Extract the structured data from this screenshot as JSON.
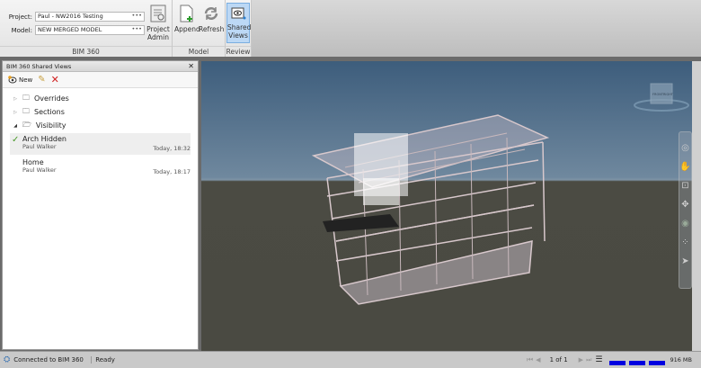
{
  "ribbon": {
    "project_label": "Project:",
    "project_value": "Paul - NW2016 Testing",
    "model_label": "Model:",
    "model_value": "NEW MERGED MODEL",
    "more": "•••",
    "project_admin": "Project Admin",
    "group_bim360": "BIM 360",
    "append": "Append",
    "refresh": "Refresh",
    "group_model": "Model",
    "shared_views": "Shared Views",
    "group_review": "Review"
  },
  "panel": {
    "title": "BIM 360 Shared Views",
    "new_label": "New",
    "folders": [
      {
        "label": "Overrides"
      },
      {
        "label": "Sections"
      },
      {
        "label": "Visibility"
      }
    ],
    "views": [
      {
        "name": "Arch Hidden",
        "user": "Paul Walker",
        "time": "Today, 18:32",
        "selected": true
      },
      {
        "name": "Home",
        "user": "Paul Walker",
        "time": "Today, 18:17",
        "selected": false
      }
    ]
  },
  "viewcube": {
    "front": "FRONT",
    "right": "RIGHT"
  },
  "status": {
    "connection": "Connected to BIM 360",
    "state": "Ready",
    "page": "1 of 1",
    "memory": "916 MB",
    "accent": "#0000e0"
  }
}
